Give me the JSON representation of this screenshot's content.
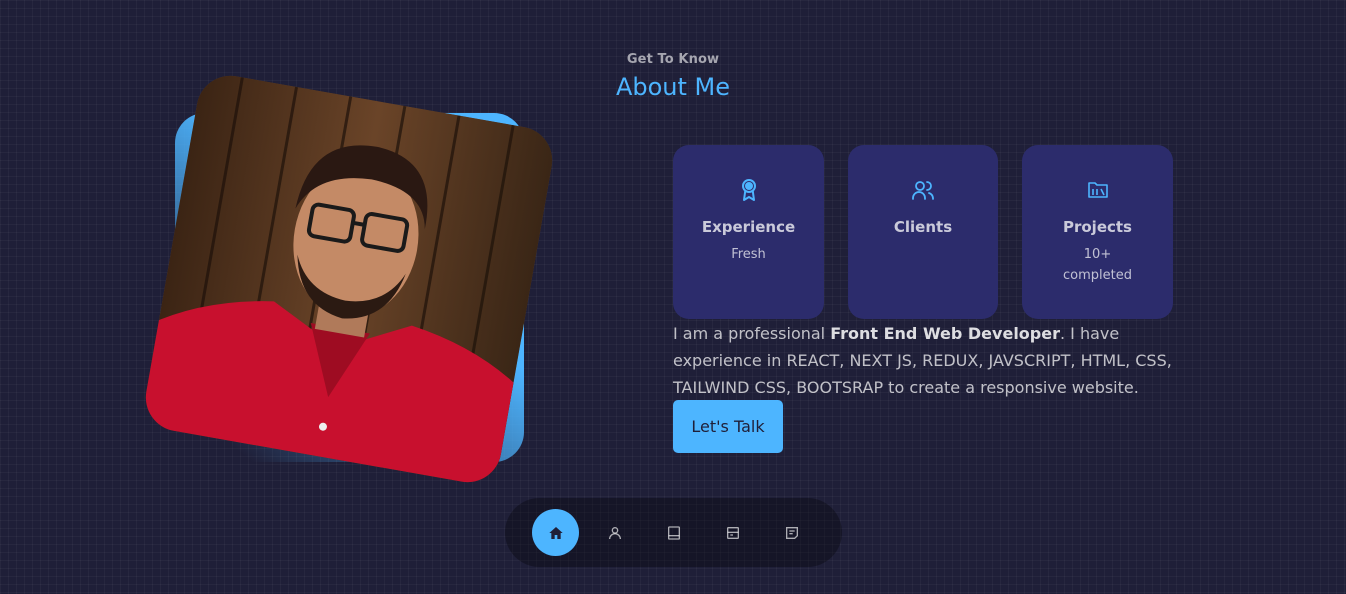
{
  "header": {
    "eyebrow": "Get To Know",
    "title": "About Me"
  },
  "photo": {
    "alt_icon": "profile-photo"
  },
  "cards": [
    {
      "icon": "award-icon",
      "title": "Experience",
      "detail": "Fresh"
    },
    {
      "icon": "users-icon",
      "title": "Clients",
      "detail": ""
    },
    {
      "icon": "folder-icon",
      "title": "Projects",
      "detail": "10+ completed"
    }
  ],
  "about": {
    "text_before": "I am a professional ",
    "text_bold": "Front End Web Developer",
    "text_after": ". I have experience in REACT, NEXT JS, REDUX, JAVSCRIPT, HTML, CSS, TAILWIND CSS, BOOTSRAP to create a responsive website.",
    "cta_label": "Let's Talk"
  },
  "nav": {
    "items": [
      {
        "icon": "home-icon",
        "active": true
      },
      {
        "icon": "user-icon",
        "active": false
      },
      {
        "icon": "book-icon",
        "active": false
      },
      {
        "icon": "services-icon",
        "active": false
      },
      {
        "icon": "message-icon",
        "active": false
      }
    ]
  },
  "colors": {
    "background": "#1f1f38",
    "accent": "#4db5ff",
    "card": "#2c2c6c"
  }
}
